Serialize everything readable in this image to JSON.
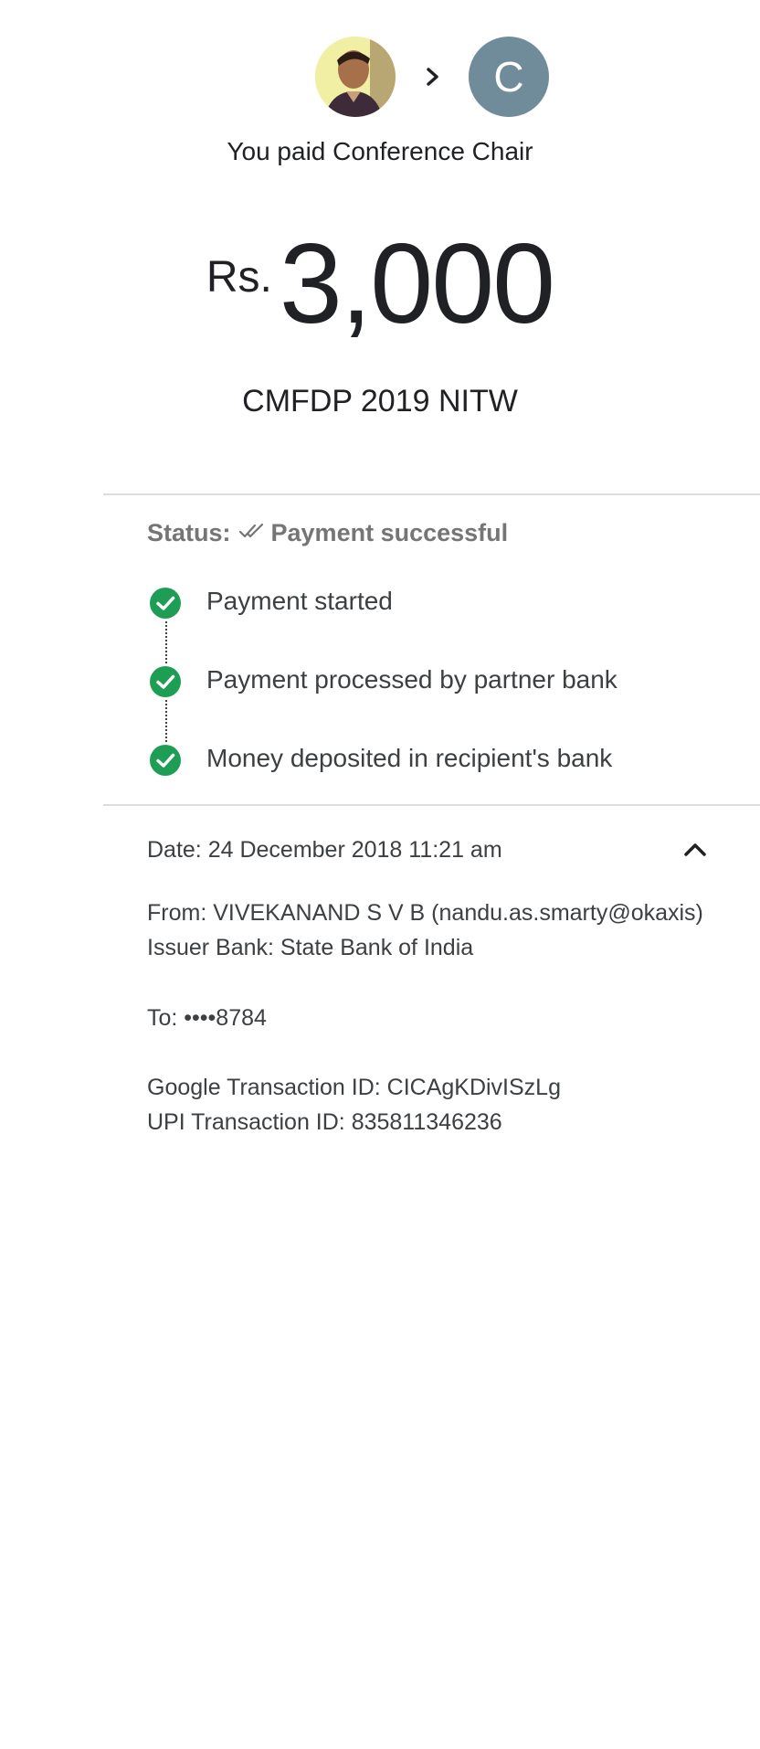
{
  "header": {
    "arrow_icon": "chevron-right-icon",
    "recipient_initial": "C",
    "recipient_avatar_color": "#708b9a",
    "paid_text": "You paid Conference Chair"
  },
  "payment": {
    "currency": "Rs.",
    "amount": "3,000",
    "note": "CMFDP 2019 NITW"
  },
  "status": {
    "label": "Status:",
    "value": "Payment successful",
    "icon": "double-check-icon",
    "color": "#757575",
    "steps": [
      {
        "label": "Payment started",
        "icon": "check-circle-icon"
      },
      {
        "label": "Payment processed by partner bank",
        "icon": "check-circle-icon"
      },
      {
        "label": "Money deposited in recipient's bank",
        "icon": "check-circle-icon"
      }
    ],
    "step_color": "#1e9e55"
  },
  "details": {
    "date": "Date: 24 December 2018 11:21 am",
    "collapse_icon": "chevron-up-icon",
    "from": "From: VIVEKANAND  S V B (nandu.as.smarty@okaxis)",
    "issuer_bank": "Issuer Bank: State Bank of India",
    "to": "To: ••••8784",
    "google_txn": "Google Transaction ID: CICAgKDivISzLg",
    "upi_txn": "UPI Transaction ID: 835811346236"
  }
}
